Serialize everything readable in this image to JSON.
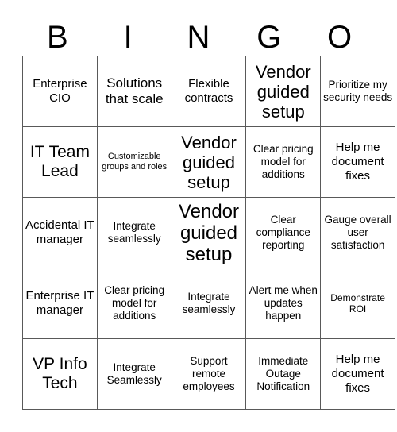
{
  "card": {
    "title_letters": [
      "B",
      "I",
      "N",
      "G",
      "O"
    ],
    "rows": [
      [
        {
          "text": "Enterprise CIO",
          "size": "fs-lg"
        },
        {
          "text": "Solutions that scale",
          "size": "fs-xl"
        },
        {
          "text": "Flexible contracts",
          "size": "fs-lg"
        },
        {
          "text": "Vendor guided setup",
          "size": "fs-3xl"
        },
        {
          "text": "Prioritize my security needs",
          "size": "fs-md"
        }
      ],
      [
        {
          "text": "IT Team Lead",
          "size": "fs-2xl"
        },
        {
          "text": "Customizable groups and roles",
          "size": "fs-xs"
        },
        {
          "text": "Vendor guided setup",
          "size": "fs-3xl"
        },
        {
          "text": "Clear pricing model for additions",
          "size": "fs-md"
        },
        {
          "text": "Help me document fixes",
          "size": "fs-lg"
        }
      ],
      [
        {
          "text": "Accidental IT manager",
          "size": "fs-lg"
        },
        {
          "text": "Integrate seamlessly",
          "size": "fs-md"
        },
        {
          "text": "Vendor guided setup",
          "size": "fs-4xl"
        },
        {
          "text": "Clear compliance reporting",
          "size": "fs-md"
        },
        {
          "text": "Gauge overall user satisfaction",
          "size": "fs-md"
        }
      ],
      [
        {
          "text": "Enterprise IT manager",
          "size": "fs-lg"
        },
        {
          "text": "Clear pricing model for additions",
          "size": "fs-md"
        },
        {
          "text": "Integrate seamlessly",
          "size": "fs-md"
        },
        {
          "text": "Alert me when updates happen",
          "size": "fs-md"
        },
        {
          "text": "Demonstrate ROI",
          "size": "fs-sm"
        }
      ],
      [
        {
          "text": "VP Info Tech",
          "size": "fs-2xl"
        },
        {
          "text": "Integrate Seamlessly",
          "size": "fs-md"
        },
        {
          "text": "Support remote employees",
          "size": "fs-md"
        },
        {
          "text": "Immediate Outage Notification",
          "size": "fs-md"
        },
        {
          "text": "Help me document fixes",
          "size": "fs-lg"
        }
      ]
    ]
  },
  "colors": {
    "background": "#ffffff",
    "text": "#000000",
    "grid_line": "#595959"
  }
}
